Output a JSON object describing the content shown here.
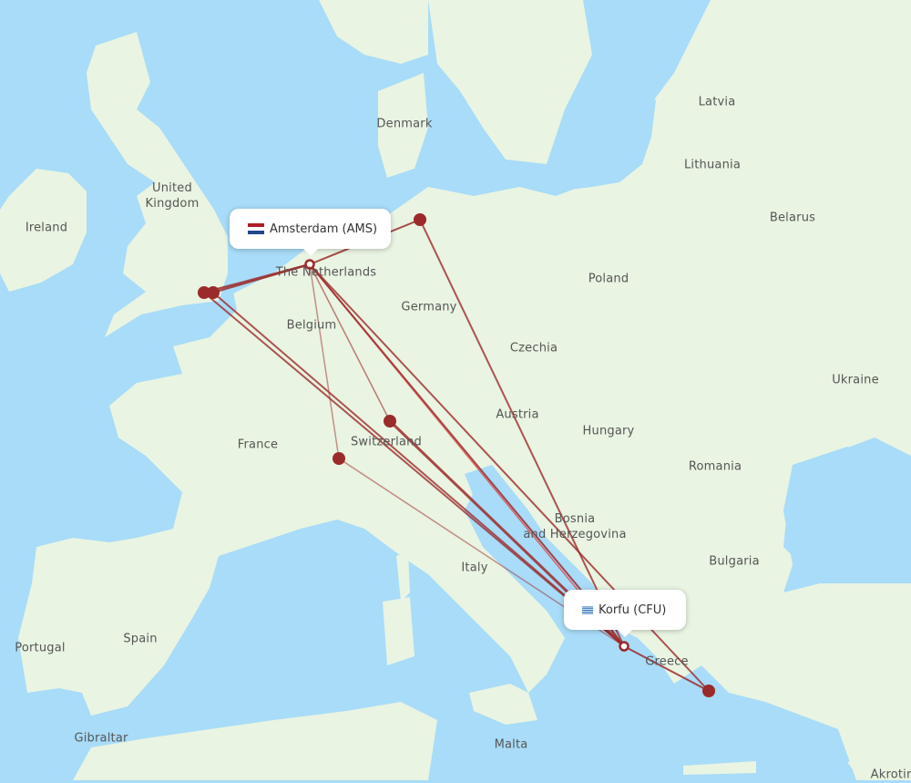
{
  "map": {
    "colors": {
      "water": "#a8dcf8",
      "land": "#e9f4e2",
      "border": "#8fcb86",
      "route": "#9b2a2a",
      "route_light": "#e05050",
      "marker": "#9b2a2a"
    },
    "origin": {
      "name": "Amsterdam (AMS)",
      "flag": "netherlands-flag"
    },
    "destination": {
      "name": "Korfu (CFU)",
      "flag": "greece-flag"
    },
    "country_labels": [
      {
        "id": "ireland",
        "text": "Ireland"
      },
      {
        "id": "uk",
        "text": "United\nKingdom"
      },
      {
        "id": "denmark",
        "text": "Denmark"
      },
      {
        "id": "latvia",
        "text": "Latvia"
      },
      {
        "id": "lithuania",
        "text": "Lithuania"
      },
      {
        "id": "belarus",
        "text": "Belarus"
      },
      {
        "id": "poland",
        "text": "Poland"
      },
      {
        "id": "netherlands",
        "text": "The Netherlands"
      },
      {
        "id": "germany",
        "text": "Germany"
      },
      {
        "id": "belgium",
        "text": "Belgium"
      },
      {
        "id": "czechia",
        "text": "Czechia"
      },
      {
        "id": "ukraine",
        "text": "Ukraine"
      },
      {
        "id": "austria",
        "text": "Austria"
      },
      {
        "id": "hungary",
        "text": "Hungary"
      },
      {
        "id": "france",
        "text": "France"
      },
      {
        "id": "switzerland",
        "text": "Switzerland"
      },
      {
        "id": "romania",
        "text": "Romania"
      },
      {
        "id": "bosnia",
        "text": "Bosnia\nand Herzegovina"
      },
      {
        "id": "bulgaria",
        "text": "Bulgaria"
      },
      {
        "id": "italy",
        "text": "Italy"
      },
      {
        "id": "spain",
        "text": "Spain"
      },
      {
        "id": "portugal",
        "text": "Portugal"
      },
      {
        "id": "greece",
        "text": "Greece"
      },
      {
        "id": "gibraltar",
        "text": "Gibraltar"
      },
      {
        "id": "malta",
        "text": "Malta"
      },
      {
        "id": "akrotiri",
        "text": "Akrotiri"
      }
    ]
  }
}
